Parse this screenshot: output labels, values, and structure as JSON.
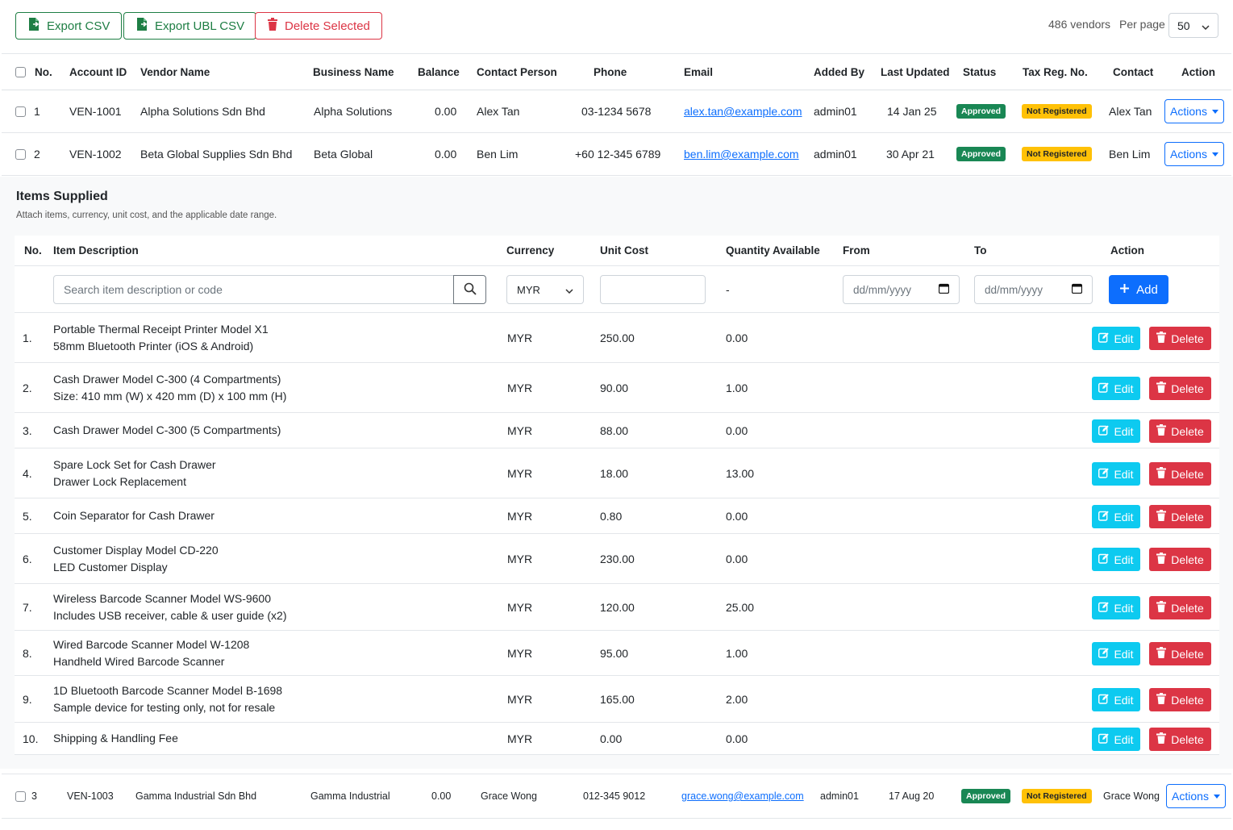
{
  "toolbar": {
    "export_csv": "Export CSV",
    "export_ubl": "Export UBL CSV",
    "delete_selected": "Delete Selected",
    "vendor_count": "486 vendors",
    "per_page_label": "Per page",
    "per_page_value": "50"
  },
  "vendor_table": {
    "headers": [
      "No.",
      "Account ID",
      "Vendor Name",
      "Business Name",
      "Balance",
      "Contact Person",
      "Phone",
      "Email",
      "Added By",
      "Last Updated",
      "Status",
      "Tax Reg. No.",
      "Contact",
      "Action"
    ],
    "rows": [
      {
        "no": "1",
        "account_id": "VEN-1001",
        "vendor_name": "Alpha Solutions Sdn Bhd",
        "business_name": "Alpha Solutions",
        "balance": "0.00",
        "contact_person": "Alex Tan",
        "phone": "03-1234 5678",
        "email": "alex.tan@example.com",
        "added_by": "admin01",
        "last_updated": "14 Jan 25",
        "status": "Approved",
        "tax_reg": "Not Registered",
        "contact": "Alex Tan",
        "action": "Actions"
      },
      {
        "no": "2",
        "account_id": "VEN-1002",
        "vendor_name": "Beta Global Supplies Sdn Bhd",
        "business_name": "Beta Global",
        "balance": "0.00",
        "contact_person": "Ben Lim",
        "phone": "+60 12-345 6789",
        "email": "ben.lim@example.com",
        "added_by": "admin01",
        "last_updated": "30 Apr 21",
        "status": "Approved",
        "tax_reg": "Not Registered",
        "contact": "Ben Lim",
        "action": "Actions"
      },
      {
        "no": "3",
        "account_id": "VEN-1003",
        "vendor_name": "Gamma Industrial Sdn Bhd",
        "business_name": "Gamma Industrial",
        "balance": "0.00",
        "contact_person": "Grace Wong",
        "phone": "012-345 9012",
        "email": "grace.wong@example.com",
        "added_by": "admin01",
        "last_updated": "17 Aug 20",
        "status": "Approved",
        "tax_reg": "Not Registered",
        "contact": "Grace Wong",
        "action": "Actions"
      }
    ]
  },
  "items_supplied": {
    "title": "Items Supplied",
    "subtitle": "Attach items, currency, unit cost, and the applicable date range.",
    "headers": [
      "No.",
      "Item Description",
      "Currency",
      "Unit Cost",
      "Quantity Available",
      "From",
      "To",
      "Action"
    ],
    "form": {
      "search_placeholder": "Search item description or code",
      "currency": "MYR",
      "unit_cost": "",
      "quantity": "-",
      "from_placeholder": "dd/mm/yyyy",
      "to_placeholder": "dd/mm/yyyy",
      "add_label": "Add"
    },
    "edit_label": "Edit",
    "delete_label": "Delete",
    "rows": [
      {
        "no": "1.",
        "line1": "Portable Thermal Receipt Printer Model X1",
        "line2": "58mm Bluetooth Printer (iOS & Android)",
        "currency": "MYR",
        "unit_cost": "250.00",
        "quantity": "0.00"
      },
      {
        "no": "2.",
        "line1": "Cash Drawer Model C-300 (4 Compartments)",
        "line2": "Size: 410 mm (W) x 420 mm (D) x 100 mm (H)",
        "currency": "MYR",
        "unit_cost": "90.00",
        "quantity": "1.00"
      },
      {
        "no": "3.",
        "line1": "Cash Drawer Model C-300 (5 Compartments)",
        "line2": "",
        "currency": "MYR",
        "unit_cost": "88.00",
        "quantity": "0.00"
      },
      {
        "no": "4.",
        "line1": "Spare Lock Set for Cash Drawer",
        "line2": "Drawer Lock Replacement",
        "currency": "MYR",
        "unit_cost": "18.00",
        "quantity": "13.00"
      },
      {
        "no": "5.",
        "line1": "Coin Separator for Cash Drawer",
        "line2": "",
        "currency": "MYR",
        "unit_cost": "0.80",
        "quantity": "0.00"
      },
      {
        "no": "6.",
        "line1": "Customer Display Model CD-220",
        "line2": "LED Customer Display",
        "currency": "MYR",
        "unit_cost": "230.00",
        "quantity": "0.00"
      },
      {
        "no": "7.",
        "line1": "Wireless Barcode Scanner Model WS-9600",
        "line2": "Includes USB receiver, cable & user guide (x2)",
        "currency": "MYR",
        "unit_cost": "120.00",
        "quantity": "25.00"
      },
      {
        "no": "8.",
        "line1": "Wired Barcode Scanner Model W-1208",
        "line2": "Handheld Wired Barcode Scanner",
        "currency": "MYR",
        "unit_cost": "95.00",
        "quantity": "1.00"
      },
      {
        "no": "9.",
        "line1": "1D Bluetooth Barcode Scanner Model B-1698",
        "line2": "Sample device for testing only, not for resale",
        "currency": "MYR",
        "unit_cost": "165.00",
        "quantity": "2.00"
      },
      {
        "no": "10.",
        "line1": "Shipping & Handling Fee",
        "line2": "",
        "currency": "MYR",
        "unit_cost": "0.00",
        "quantity": "0.00"
      }
    ]
  },
  "colors": {
    "primary": "#0d6efd",
    "success": "#198754",
    "danger": "#dc3545",
    "info": "#0dcaf0",
    "warning": "#ffc107"
  }
}
